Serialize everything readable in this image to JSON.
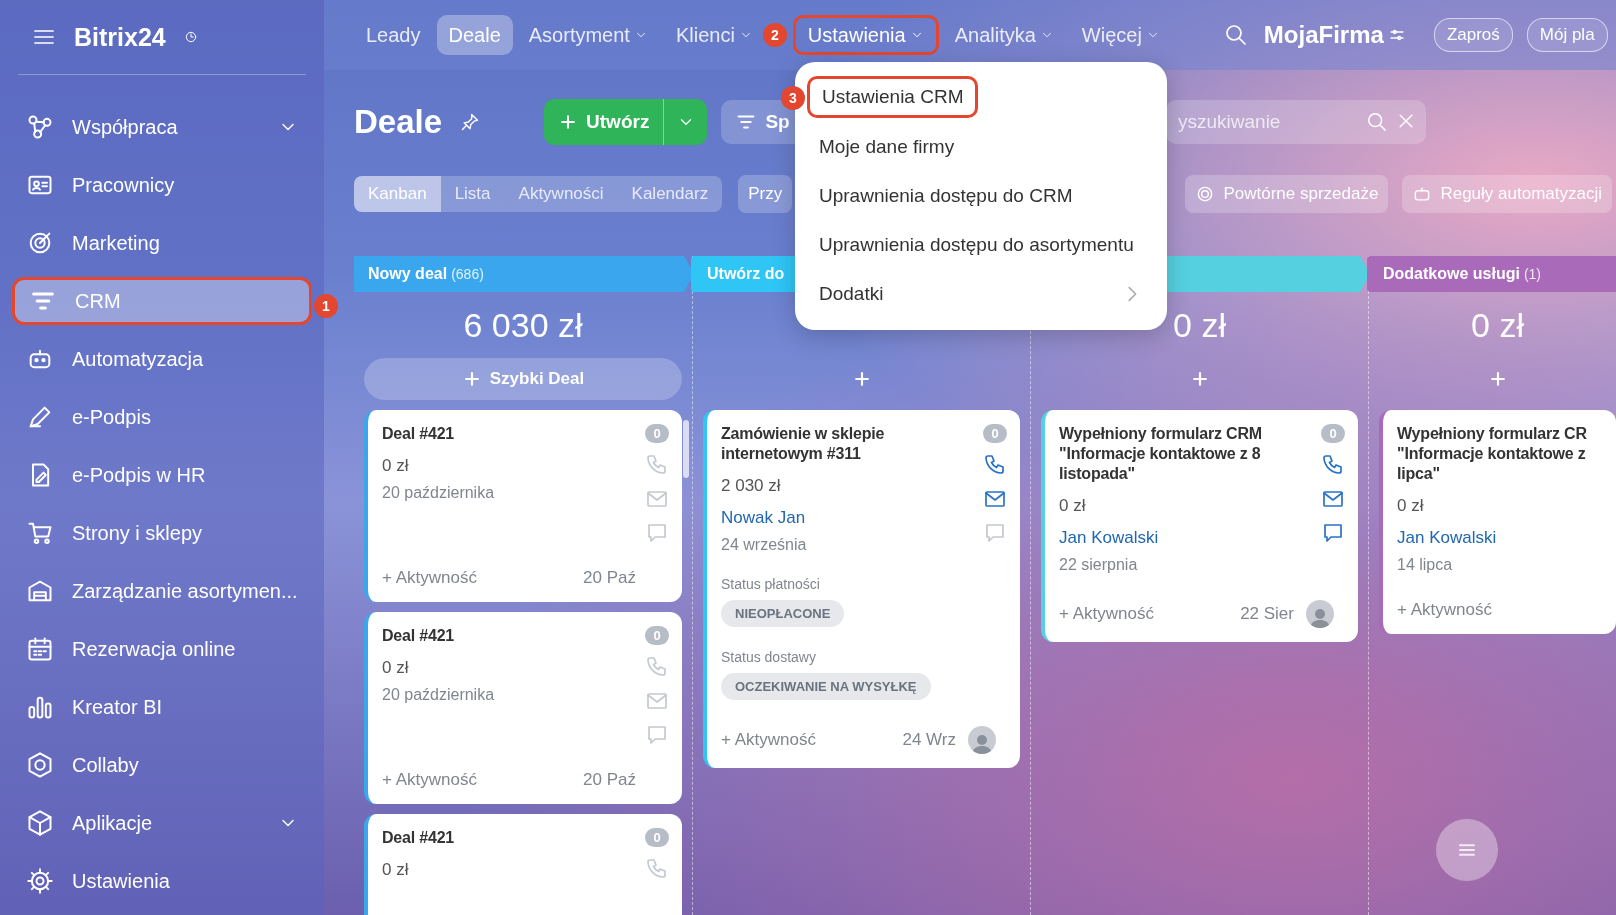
{
  "sidebar": {
    "brand": "Bitrix24",
    "items": [
      {
        "label": "Współpraca",
        "selected": false,
        "expandable": true
      },
      {
        "label": "Pracownicy",
        "selected": false,
        "expandable": false
      },
      {
        "label": "Marketing",
        "selected": false,
        "expandable": false
      },
      {
        "label": "CRM",
        "selected": true,
        "expandable": false,
        "callout": "1"
      },
      {
        "label": "Automatyzacja",
        "selected": false,
        "expandable": false
      },
      {
        "label": "e-Podpis",
        "selected": false,
        "expandable": false
      },
      {
        "label": "e-Podpis w HR",
        "selected": false,
        "expandable": false
      },
      {
        "label": "Strony i sklepy",
        "selected": false,
        "expandable": false
      },
      {
        "label": "Zarządzanie asortymen...",
        "selected": false,
        "expandable": false
      },
      {
        "label": "Rezerwacja online",
        "selected": false,
        "expandable": false
      },
      {
        "label": "Kreator BI",
        "selected": false,
        "expandable": false
      },
      {
        "label": "Collaby",
        "selected": false,
        "expandable": false
      },
      {
        "label": "Aplikacje",
        "selected": false,
        "expandable": true
      },
      {
        "label": "Ustawienia",
        "selected": false,
        "expandable": false
      }
    ]
  },
  "topnav": {
    "items": [
      {
        "label": "Leady",
        "selected": false,
        "dropdown": false
      },
      {
        "label": "Deale",
        "selected": true,
        "dropdown": false
      },
      {
        "label": "Asortyment",
        "selected": false,
        "dropdown": true
      },
      {
        "label": "Klienci",
        "selected": false,
        "dropdown": true
      },
      {
        "label": "Ustawienia",
        "selected": false,
        "dropdown": true,
        "callout": "2"
      },
      {
        "label": "Analityka",
        "selected": false,
        "dropdown": true
      },
      {
        "label": "Więcej",
        "selected": false,
        "dropdown": true
      }
    ],
    "company": "MojaFirma",
    "buttons": [
      "Zaproś",
      "Mój pla"
    ]
  },
  "settings_menu": {
    "items": [
      {
        "label": "Ustawienia CRM",
        "submenu": false,
        "callout": "3"
      },
      {
        "label": "Moje dane firmy",
        "submenu": false
      },
      {
        "label": "Uprawnienia dostępu do CRM",
        "submenu": false
      },
      {
        "label": "Uprawnienia dostępu do asortymentu",
        "submenu": false
      },
      {
        "label": "Dodatki",
        "submenu": true
      }
    ]
  },
  "page": {
    "title": "Deale",
    "create_button": "Utwórz",
    "filter_button": "Sp",
    "search_placeholder": "yszukiwanie",
    "views": [
      {
        "label": "Kanban",
        "selected": true
      },
      {
        "label": "Lista",
        "selected": false
      },
      {
        "label": "Aktywności",
        "selected": false
      },
      {
        "label": "Kalendarz",
        "selected": false
      }
    ],
    "preset_button": "Przy",
    "tools": [
      "Powtórne sprzedaże",
      "Reguły automatyzacji"
    ]
  },
  "columns": [
    {
      "name": "Nowy deal",
      "count": "(686)",
      "color": "#3aa6ee",
      "total": "6 030 zł",
      "quick_add": "Szybki Deal",
      "cards": [
        {
          "title": "Deal #421",
          "amount": "0 zł",
          "date": "20 października",
          "counter": "0",
          "channels": [
            {
              "kind": "phone",
              "active": false
            },
            {
              "kind": "mail",
              "active": false
            },
            {
              "kind": "chat",
              "active": false
            }
          ],
          "activity": "+ Aktywność",
          "due": "20 Paź",
          "avatar": false
        },
        {
          "title": "Deal #421",
          "amount": "0 zł",
          "date": "20 października",
          "counter": "0",
          "channels": [
            {
              "kind": "phone",
              "active": false
            },
            {
              "kind": "mail",
              "active": false
            },
            {
              "kind": "chat",
              "active": false
            }
          ],
          "activity": "+ Aktywność",
          "due": "20 Paź",
          "avatar": false
        },
        {
          "title": "Deal #421",
          "amount": "0 zł",
          "counter": "0",
          "channels": [
            {
              "kind": "phone",
              "active": false
            }
          ]
        }
      ]
    },
    {
      "name": "Utwórz do",
      "color": "#2fc6f6",
      "cards": [
        {
          "title": "Zamówienie w sklepie internetowym #311",
          "amount": "2 030 zł",
          "contact": "Nowak Jan",
          "date": "24 września",
          "counter": "0",
          "channels": [
            {
              "kind": "phone",
              "active": true
            },
            {
              "kind": "mail",
              "active": true
            },
            {
              "kind": "chat",
              "active": false
            }
          ],
          "statuses": [
            {
              "label": "Status płatności",
              "value": "NIEOPŁACONE"
            },
            {
              "label": "Status dostawy",
              "value": "OCZEKIWANIE NA WYSYŁKĘ"
            }
          ],
          "activity": "+ Aktywność",
          "due": "24 Wrz",
          "avatar": true
        }
      ]
    },
    {
      "color": "#55d0e0",
      "total": "0 zł",
      "cards": [
        {
          "title": "Wypełniony formularz CRM \"Informacje kontaktowe z 8 listopada\"",
          "amount": "0 zł",
          "contact": "Jan Kowalski",
          "date": "22 sierpnia",
          "counter": "0",
          "channels": [
            {
              "kind": "phone",
              "active": true
            },
            {
              "kind": "mail",
              "active": true
            },
            {
              "kind": "chat",
              "active": true
            }
          ],
          "activity": "+ Aktywność",
          "due": "22 Sier",
          "avatar": true
        }
      ]
    },
    {
      "name": "Dodatkowe usługi",
      "count": "(1)",
      "color": "#a86ab9",
      "total": "0 zł",
      "cards": [
        {
          "title": "Wypełniony formularz CR\n\"Informacje kontaktowe z\nlipca\"",
          "amount": "0 zł",
          "contact": "Jan Kowalski",
          "date": "14 lipca",
          "activity": "+ Aktywność",
          "avatar": false
        }
      ]
    }
  ]
}
